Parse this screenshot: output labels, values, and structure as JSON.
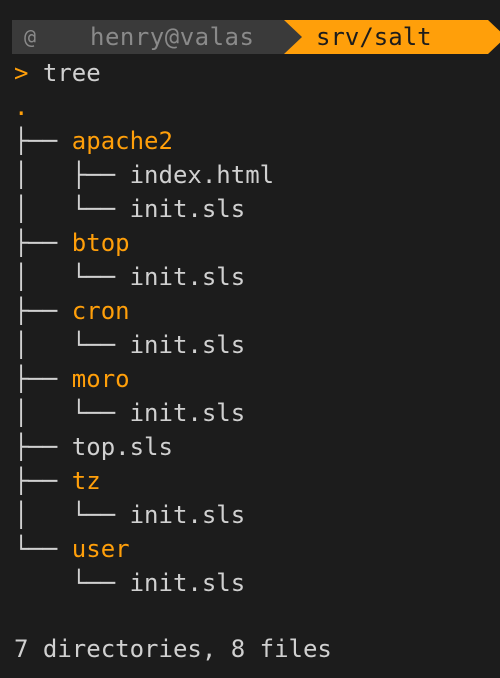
{
  "prompt": {
    "os_icon": "os-icon",
    "user_host": "henry@valas",
    "path": "srv/salt",
    "caret": ">",
    "command": "tree"
  },
  "tree": {
    "root": ".",
    "rows": [
      {
        "prefix": "├── ",
        "name": "apache2",
        "kind": "dir"
      },
      {
        "prefix": "│   ├── ",
        "name": "index.html",
        "kind": "file"
      },
      {
        "prefix": "│   └── ",
        "name": "init.sls",
        "kind": "file"
      },
      {
        "prefix": "├── ",
        "name": "btop",
        "kind": "dir"
      },
      {
        "prefix": "│   └── ",
        "name": "init.sls",
        "kind": "file"
      },
      {
        "prefix": "├── ",
        "name": "cron",
        "kind": "dir"
      },
      {
        "prefix": "│   └── ",
        "name": "init.sls",
        "kind": "file"
      },
      {
        "prefix": "├── ",
        "name": "moro",
        "kind": "dir"
      },
      {
        "prefix": "│   └── ",
        "name": "init.sls",
        "kind": "file"
      },
      {
        "prefix": "├── ",
        "name": "top.sls",
        "kind": "file"
      },
      {
        "prefix": "├── ",
        "name": "tz",
        "kind": "dir"
      },
      {
        "prefix": "│   └── ",
        "name": "init.sls",
        "kind": "file"
      },
      {
        "prefix": "└── ",
        "name": "user",
        "kind": "dir"
      },
      {
        "prefix": "    └── ",
        "name": "init.sls",
        "kind": "file"
      }
    ]
  },
  "summary": "7 directories, 8 files",
  "colors": {
    "background": "#1c1c1c",
    "accent": "#ff9f0a",
    "text": "#d0d0d0",
    "segment": "#3a3a3a"
  }
}
